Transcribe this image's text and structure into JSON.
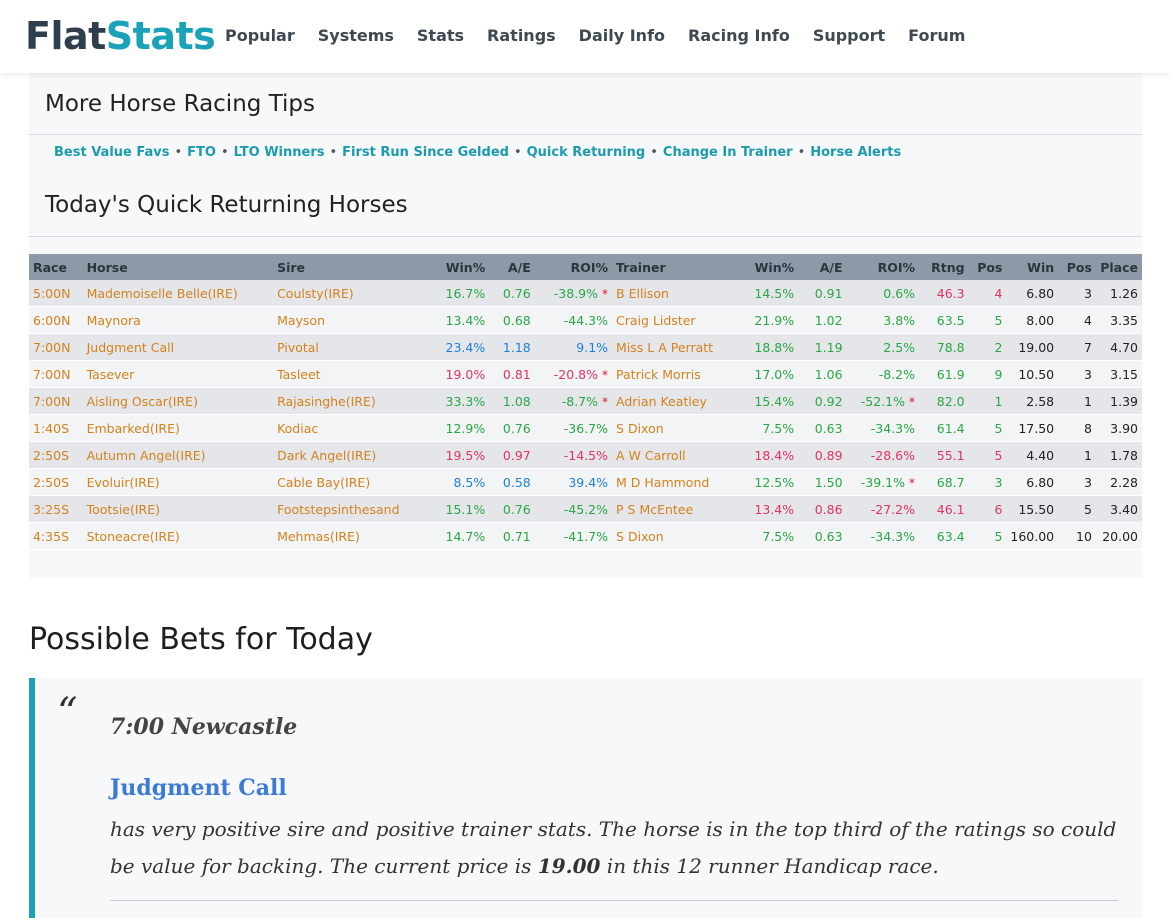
{
  "nav": {
    "logo_part1": "Flat",
    "logo_part2": "Stats",
    "items": [
      "Popular",
      "Systems",
      "Stats",
      "Ratings",
      "Daily Info",
      "Racing Info",
      "Support",
      "Forum"
    ]
  },
  "more_tips": {
    "heading": "More Horse Racing Tips",
    "links": [
      "Best Value Favs",
      "FTO",
      "LTO Winners",
      "First Run Since Gelded",
      "Quick Returning",
      "Change In Trainer",
      "Horse Alerts"
    ],
    "separator": "•"
  },
  "quick_returning": {
    "heading": "Today's Quick Returning Horses",
    "headers": [
      "Race",
      "Horse",
      "Sire",
      "Win%",
      "A/E",
      "ROI%",
      "Trainer",
      "Win%",
      "A/E",
      "ROI%",
      "Rtng",
      "Pos",
      "Win",
      "Pos",
      "Place"
    ],
    "rows": [
      {
        "race": "5:00N",
        "horse": "Mademoiselle Belle(IRE)",
        "sire": "Coulsty(IRE)",
        "s_win": "16.7%",
        "s_ae": "0.76",
        "s_roi": "-38.9%",
        "s_star": true,
        "trainer": "B Ellison",
        "t_win": "14.5%",
        "t_ae": "0.91",
        "t_roi": "0.6%",
        "t_star": false,
        "rtng": "46.3",
        "pos": "4",
        "win": "6.80",
        "pos2": "3",
        "place": "1.26",
        "c": {
          "s_win": "gr",
          "s_ae": "gr",
          "s_roi": "gr",
          "t_win": "gr",
          "t_ae": "gr",
          "t_roi": "gr",
          "rtng": "rd",
          "pos": "rd"
        }
      },
      {
        "race": "6:00N",
        "horse": "Maynora",
        "sire": "Mayson",
        "s_win": "13.4%",
        "s_ae": "0.68",
        "s_roi": "-44.3%",
        "s_star": false,
        "trainer": "Craig Lidster",
        "t_win": "21.9%",
        "t_ae": "1.02",
        "t_roi": "3.8%",
        "t_star": false,
        "rtng": "63.5",
        "pos": "5",
        "win": "8.00",
        "pos2": "4",
        "place": "3.35",
        "c": {
          "s_win": "gr",
          "s_ae": "gr",
          "s_roi": "gr",
          "t_win": "gr",
          "t_ae": "gr",
          "t_roi": "gr",
          "rtng": "gr",
          "pos": "gr"
        }
      },
      {
        "race": "7:00N",
        "horse": "Judgment Call",
        "sire": "Pivotal",
        "s_win": "23.4%",
        "s_ae": "1.18",
        "s_roi": "9.1%",
        "s_star": false,
        "trainer": "Miss L A Perratt",
        "t_win": "18.8%",
        "t_ae": "1.19",
        "t_roi": "2.5%",
        "t_star": false,
        "rtng": "78.8",
        "pos": "2",
        "win": "19.00",
        "pos2": "7",
        "place": "4.70",
        "c": {
          "s_win": "bl",
          "s_ae": "bl",
          "s_roi": "bl",
          "t_win": "gr",
          "t_ae": "gr",
          "t_roi": "gr",
          "rtng": "gr",
          "pos": "gr"
        }
      },
      {
        "race": "7:00N",
        "horse": "Tasever",
        "sire": "Tasleet",
        "s_win": "19.0%",
        "s_ae": "0.81",
        "s_roi": "-20.8%",
        "s_star": true,
        "trainer": "Patrick Morris",
        "t_win": "17.0%",
        "t_ae": "1.06",
        "t_roi": "-8.2%",
        "t_star": false,
        "rtng": "61.9",
        "pos": "9",
        "win": "10.50",
        "pos2": "3",
        "place": "3.15",
        "c": {
          "s_win": "rd",
          "s_ae": "rd",
          "s_roi": "rd",
          "t_win": "gr",
          "t_ae": "gr",
          "t_roi": "gr",
          "rtng": "gr",
          "pos": "gr"
        }
      },
      {
        "race": "7:00N",
        "horse": "Aisling Oscar(IRE)",
        "sire": "Rajasinghe(IRE)",
        "s_win": "33.3%",
        "s_ae": "1.08",
        "s_roi": "-8.7%",
        "s_star": true,
        "trainer": "Adrian Keatley",
        "t_win": "15.4%",
        "t_ae": "0.92",
        "t_roi": "-52.1%",
        "t_star": true,
        "rtng": "82.0",
        "pos": "1",
        "win": "2.58",
        "pos2": "1",
        "place": "1.39",
        "c": {
          "s_win": "gr",
          "s_ae": "gr",
          "s_roi": "gr",
          "t_win": "gr",
          "t_ae": "gr",
          "t_roi": "gr",
          "rtng": "gr",
          "pos": "gr"
        }
      },
      {
        "race": "1:40S",
        "horse": "Embarked(IRE)",
        "sire": "Kodiac",
        "s_win": "12.9%",
        "s_ae": "0.76",
        "s_roi": "-36.7%",
        "s_star": false,
        "trainer": "S Dixon",
        "t_win": "7.5%",
        "t_ae": "0.63",
        "t_roi": "-34.3%",
        "t_star": false,
        "rtng": "61.4",
        "pos": "5",
        "win": "17.50",
        "pos2": "8",
        "place": "3.90",
        "c": {
          "s_win": "gr",
          "s_ae": "gr",
          "s_roi": "gr",
          "t_win": "gr",
          "t_ae": "gr",
          "t_roi": "gr",
          "rtng": "gr",
          "pos": "gr"
        }
      },
      {
        "race": "2:50S",
        "horse": "Autumn Angel(IRE)",
        "sire": "Dark Angel(IRE)",
        "s_win": "19.5%",
        "s_ae": "0.97",
        "s_roi": "-14.5%",
        "s_star": false,
        "trainer": "A W Carroll",
        "t_win": "18.4%",
        "t_ae": "0.89",
        "t_roi": "-28.6%",
        "t_star": false,
        "rtng": "55.1",
        "pos": "5",
        "win": "4.40",
        "pos2": "1",
        "place": "1.78",
        "c": {
          "s_win": "rd",
          "s_ae": "rd",
          "s_roi": "rd",
          "t_win": "rd",
          "t_ae": "rd",
          "t_roi": "rd",
          "rtng": "rd",
          "pos": "rd"
        }
      },
      {
        "race": "2:50S",
        "horse": "Evoluir(IRE)",
        "sire": "Cable Bay(IRE)",
        "s_win": "8.5%",
        "s_ae": "0.58",
        "s_roi": "39.4%",
        "s_star": false,
        "trainer": "M D Hammond",
        "t_win": "12.5%",
        "t_ae": "1.50",
        "t_roi": "-39.1%",
        "t_star": true,
        "rtng": "68.7",
        "pos": "3",
        "win": "6.80",
        "pos2": "3",
        "place": "2.28",
        "c": {
          "s_win": "bl",
          "s_ae": "bl",
          "s_roi": "bl",
          "t_win": "gr",
          "t_ae": "gr",
          "t_roi": "gr",
          "rtng": "gr",
          "pos": "gr"
        }
      },
      {
        "race": "3:25S",
        "horse": "Tootsie(IRE)",
        "sire": "Footstepsinthesand",
        "s_win": "15.1%",
        "s_ae": "0.76",
        "s_roi": "-45.2%",
        "s_star": false,
        "trainer": "P S McEntee",
        "t_win": "13.4%",
        "t_ae": "0.86",
        "t_roi": "-27.2%",
        "t_star": false,
        "rtng": "46.1",
        "pos": "6",
        "win": "15.50",
        "pos2": "5",
        "place": "3.40",
        "c": {
          "s_win": "gr",
          "s_ae": "gr",
          "s_roi": "gr",
          "t_win": "rd",
          "t_ae": "rd",
          "t_roi": "rd",
          "rtng": "rd",
          "pos": "rd"
        }
      },
      {
        "race": "4:35S",
        "horse": "Stoneacre(IRE)",
        "sire": "Mehmas(IRE)",
        "s_win": "14.7%",
        "s_ae": "0.71",
        "s_roi": "-41.7%",
        "s_star": false,
        "trainer": "S Dixon",
        "t_win": "7.5%",
        "t_ae": "0.63",
        "t_roi": "-34.3%",
        "t_star": false,
        "rtng": "63.4",
        "pos": "5",
        "win": "160.00",
        "pos2": "10",
        "place": "20.00",
        "c": {
          "s_win": "gr",
          "s_ae": "gr",
          "s_roi": "gr",
          "t_win": "gr",
          "t_ae": "gr",
          "t_roi": "gr",
          "rtng": "gr",
          "pos": "gr"
        }
      }
    ]
  },
  "possible_bets": {
    "heading": "Possible Bets for Today",
    "quote_mark": "“",
    "venue": "7:00 Newcastle",
    "horse": "Judgment Call",
    "desc_before": "has very positive sire and positive trainer stats. The horse is in the top third of the ratings so could be value for backing. The current price is ",
    "price": "19.00",
    "desc_after": " in this 12 runner Handicap race."
  },
  "colors": {
    "brand_teal": "#1aa3b8",
    "logo_dark": "#2f3e4c",
    "orange": "#d4821c",
    "green": "#2aa744",
    "blue": "#1f7fd6",
    "red": "#e03462",
    "star_red": "#e0142c",
    "link_blue": "#3c7ad6"
  }
}
